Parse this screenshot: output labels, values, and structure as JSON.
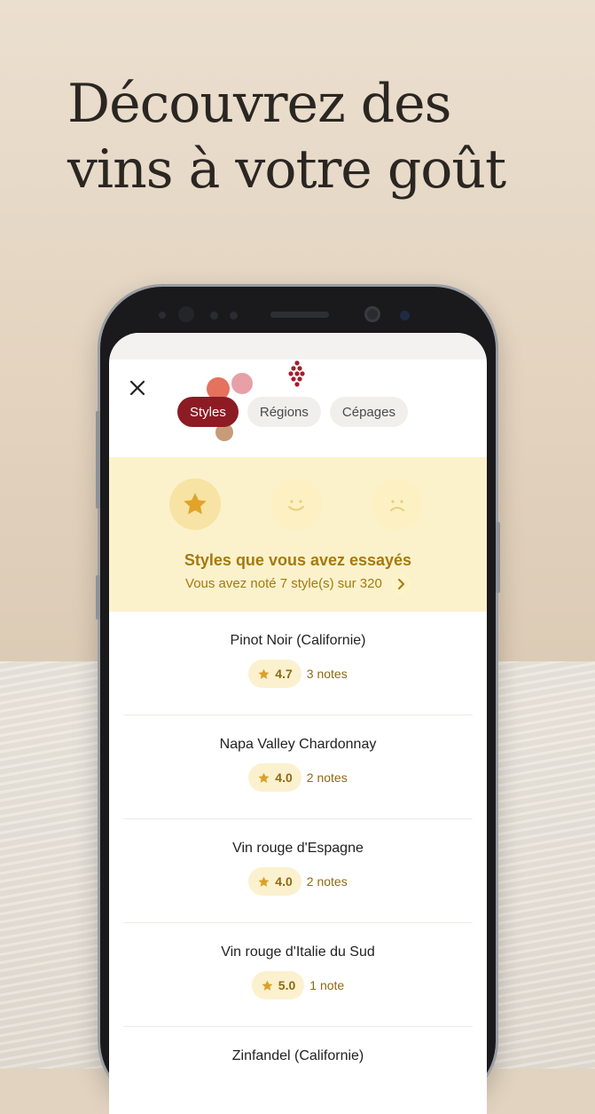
{
  "headline": {
    "line1": "Découvrez des",
    "line2": "vins à votre goût"
  },
  "app": {
    "close_icon": "close-icon",
    "logo_icon": "grape-logo-icon",
    "tabs": [
      {
        "label": "Styles",
        "active": true
      },
      {
        "label": "Régions",
        "active": false
      },
      {
        "label": "Cépages",
        "active": false
      }
    ],
    "panel": {
      "icons": [
        "star-icon",
        "smile-face-icon",
        "sad-face-icon"
      ],
      "title": "Styles que vous avez essayés",
      "subtitle": "Vous avez noté 7 style(s) sur 320"
    },
    "styles": [
      {
        "name": "Pinot Noir (Californie)",
        "rating": "4.7",
        "notes": "3 notes"
      },
      {
        "name": "Napa Valley Chardonnay",
        "rating": "4.0",
        "notes": "2 notes"
      },
      {
        "name": "Vin rouge d'Espagne",
        "rating": "4.0",
        "notes": "2 notes"
      },
      {
        "name": "Vin rouge d'Italie du Sud",
        "rating": "5.0",
        "notes": "1 note"
      },
      {
        "name": "Zinfandel (Californie)",
        "rating": "",
        "notes": ""
      }
    ]
  },
  "colors": {
    "accent": "#8c1b24",
    "gold": "#a6790f",
    "panel_bg": "#fbf2cc"
  }
}
